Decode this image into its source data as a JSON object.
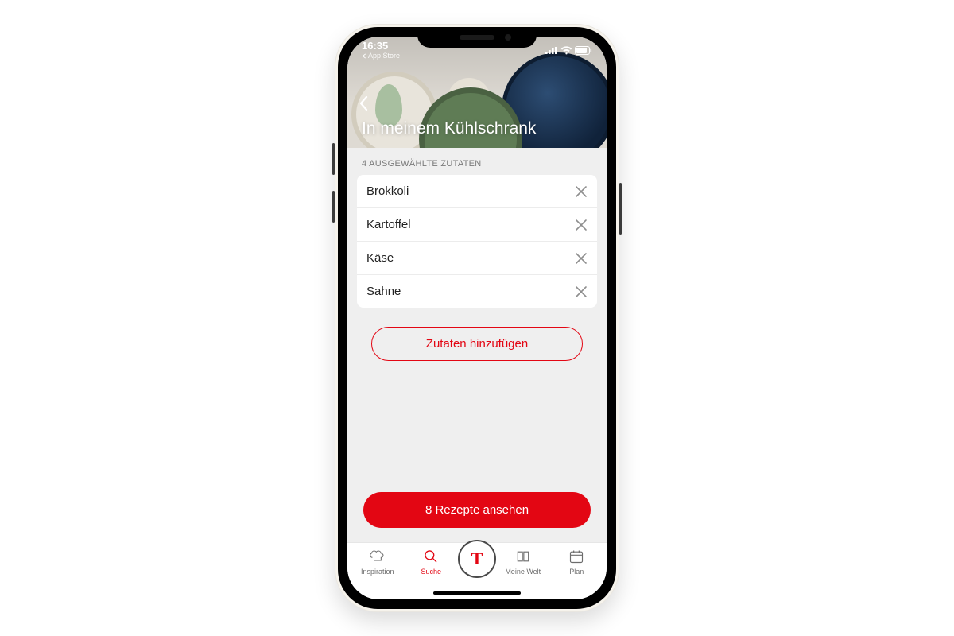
{
  "status": {
    "time": "16:35",
    "back_label": "App Store"
  },
  "header": {
    "title": "In meinem Kühlschrank"
  },
  "section_label": "4 AUSGEWÄHLTE ZUTATEN",
  "ingredients": [
    {
      "name": "Brokkoli"
    },
    {
      "name": "Kartoffel"
    },
    {
      "name": "Käse"
    },
    {
      "name": "Sahne"
    }
  ],
  "buttons": {
    "add": "Zutaten hinzufügen",
    "view": "8 Rezepte ansehen"
  },
  "tabs": {
    "inspiration": "Inspiration",
    "suche": "Suche",
    "center": "T",
    "meine_welt": "Meine Welt",
    "plan": "Plan"
  },
  "colors": {
    "accent": "#e30613"
  }
}
